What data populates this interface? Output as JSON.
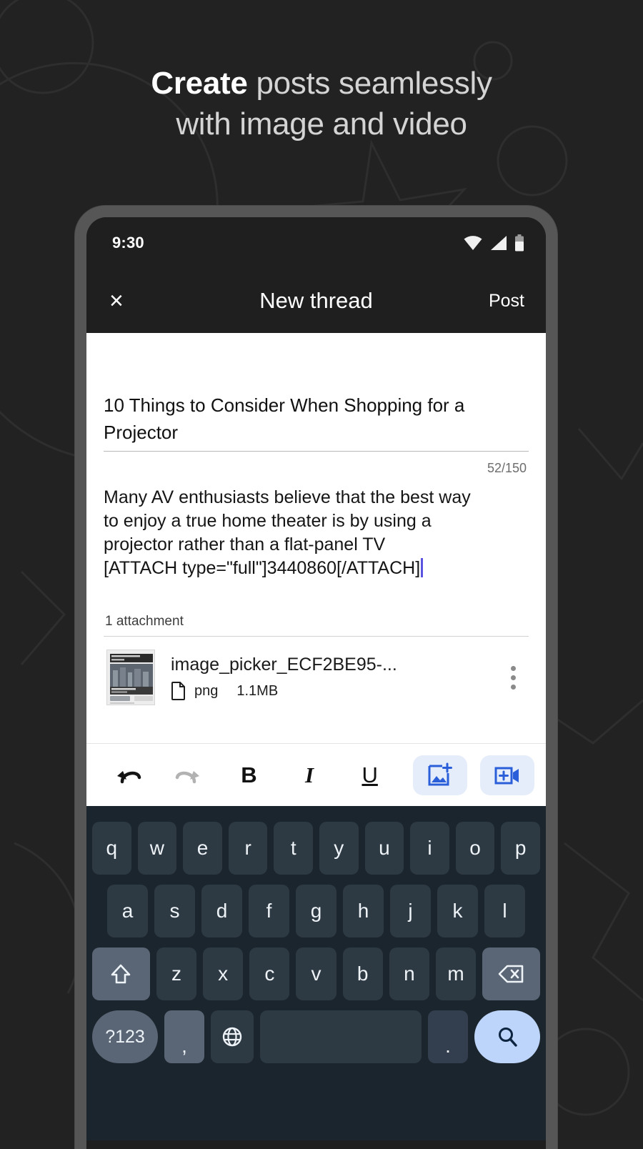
{
  "headline": {
    "bold_word": "Create",
    "rest_line1": " posts seamlessly",
    "line2": "with image and video",
    "text_color": "#d4d4d4",
    "bold_color": "#ffffff"
  },
  "background": {
    "color": "#222222"
  },
  "phone": {
    "bezel_color": "#565656",
    "screen_color": "#1f1f1f"
  },
  "status_bar": {
    "time": "9:30",
    "icons": [
      "wifi-icon",
      "cellular-signal-icon",
      "battery-icon"
    ]
  },
  "app_bar": {
    "close_label": "×",
    "title": "New thread",
    "action_label": "Post"
  },
  "editor": {
    "title_value": "10 Things to Consider When Shopping for a Projector",
    "char_counter": "52/150",
    "body_line1": "Many AV enthusiasts believe that the best way",
    "body_line2": "to enjoy a true home theater is by using a",
    "body_line3": "projector rather than a flat-panel TV",
    "body_line4": "[ATTACH type=\"full\"]3440860[/ATTACH]",
    "attachments_label": "1 attachment"
  },
  "attachment": {
    "filename": "image_picker_ECF2BE95-...",
    "filetype": "png",
    "filesize": "1.1MB",
    "menu_icon": "kebab-menu-icon",
    "thumbnail_icon": "image-thumbnail"
  },
  "toolbar": {
    "undo": "undo-icon",
    "redo": "redo-icon",
    "bold_label": "B",
    "italic_label": "I",
    "underline_label": "U",
    "add_image": "add-image-icon",
    "add_video": "add-video-icon",
    "accent_color": "#2a5fd9",
    "pill_bg": "#e5edfb"
  },
  "keyboard": {
    "bg_color": "#1b252d",
    "key_color": "#2d3943",
    "row1": [
      "q",
      "w",
      "e",
      "r",
      "t",
      "y",
      "u",
      "i",
      "o",
      "p"
    ],
    "row2": [
      "a",
      "s",
      "d",
      "f",
      "g",
      "h",
      "j",
      "k",
      "l"
    ],
    "row3": [
      "z",
      "x",
      "c",
      "v",
      "b",
      "n",
      "m"
    ],
    "shift_icon": "shift-icon",
    "backspace_icon": "backspace-icon",
    "symbols_label": "?123",
    "comma_label": ",",
    "globe_icon": "globe-icon",
    "space_label": "",
    "period_label": ".",
    "enter_icon": "search-icon"
  }
}
